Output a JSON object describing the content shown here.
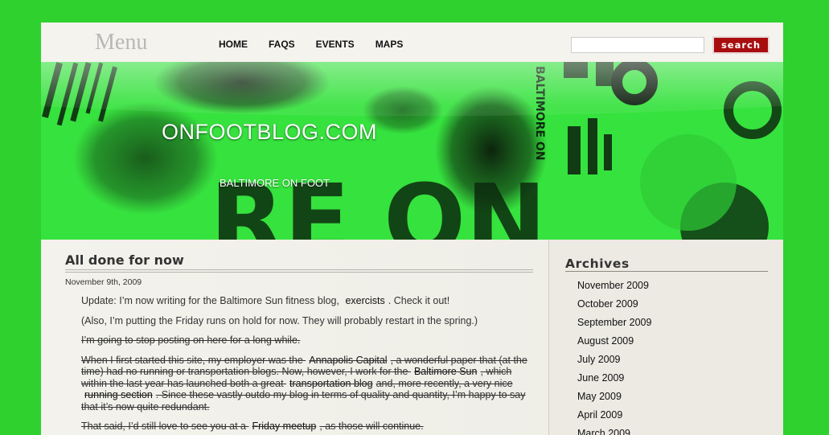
{
  "header": {
    "menu_logo": "Menu",
    "nav": [
      "HOME",
      "FAQS",
      "EVENTS",
      "MAPS"
    ],
    "search_placeholder": "",
    "search_label": "search"
  },
  "banner": {
    "title": "ONFOOTBLOG.COM",
    "tagline": "BALTIMORE ON FOOT",
    "background_text": [
      "RE ON",
      "BALTIMORE ON"
    ]
  },
  "post": {
    "title": "All done for now",
    "date": "November 9th, 2009",
    "p1_before": "Update: I’m now writing for the Baltimore Sun fitness blog,",
    "p1_link": "exercists",
    "p1_after": ". Check it out!",
    "p2": "(Also, I’m putting the Friday runs on hold for now. They will probably restart in the spring.)",
    "p3": "I’m going to stop posting on here for a long while.",
    "p4_a": "When I first started this site, my employer was the",
    "p4_link1": "Annapolis Capital",
    "p4_b": ", a wonderful paper that (at the time) had no running or transportation blogs. Now, however, I work for the",
    "p4_link2": "Baltimore Sun",
    "p4_c": ", which within the last year has launched both a great",
    "p4_link3": "transportation blog",
    "p4_d": "and, more recently, a very nice",
    "p4_link4": "running section",
    "p4_e": ". Since these vastly outdo my blog in terms of quality and quantity, I’m happy to say that it’s now quite redundant.",
    "p5_a": "That said, I’d still love to see you at a",
    "p5_link": "Friday meetup",
    "p5_b": ", as those will continue."
  },
  "sidebar": {
    "archives_title": "Archives",
    "archives": [
      "November 2009",
      "October 2009",
      "September 2009",
      "August 2009",
      "July 2009",
      "June 2009",
      "May 2009",
      "April 2009",
      "March 2009"
    ]
  },
  "colors": {
    "page_background": "#2fd12f",
    "search_button": "#a80e10",
    "banner_green": "#35e43d"
  }
}
